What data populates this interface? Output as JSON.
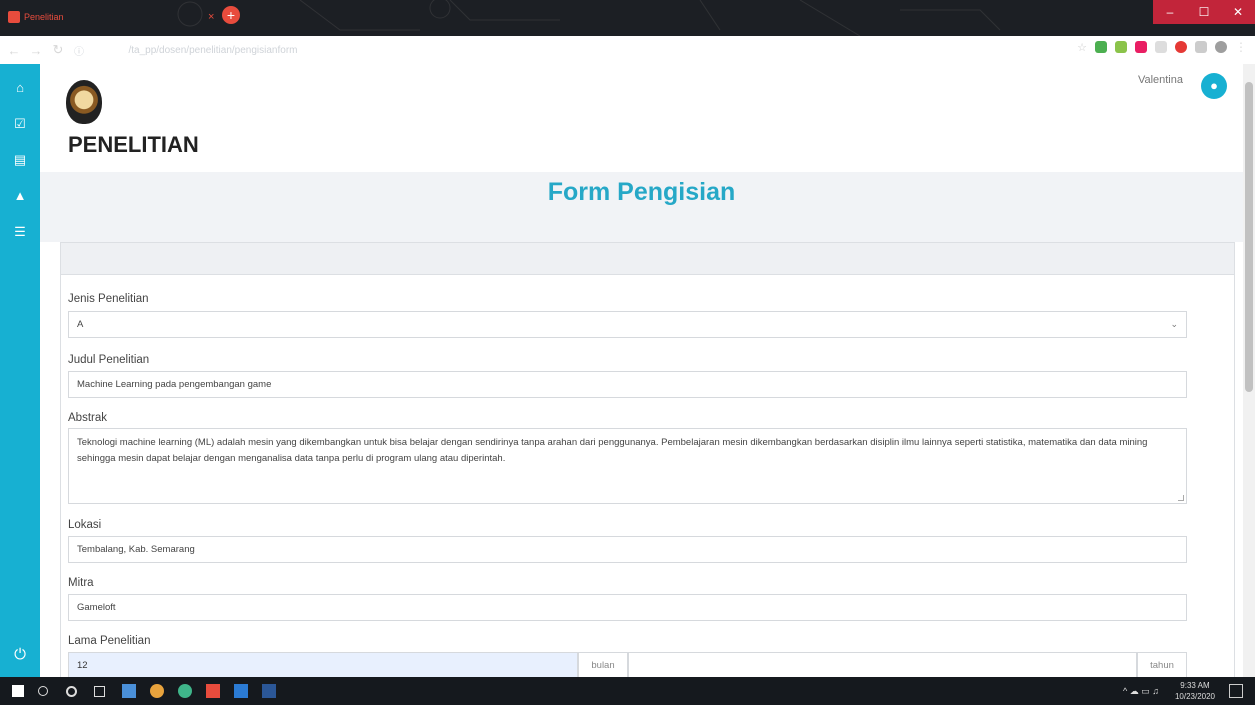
{
  "browser": {
    "tab_title": "Penelitian",
    "url_host": "localhost",
    "url_path": "/ta_pp/dosen/penelitian/pengisianform",
    "new_tab": "+",
    "close_tab": "×"
  },
  "window": {
    "minimize": "–",
    "maximize": "☐",
    "close": "✕"
  },
  "sidebar": {
    "items": [
      {
        "name": "home-icon",
        "glyph": "⌂"
      },
      {
        "name": "checkbox-icon",
        "glyph": "☑"
      },
      {
        "name": "document-icon",
        "glyph": "▤"
      },
      {
        "name": "warning-icon",
        "glyph": "▲"
      },
      {
        "name": "list-icon",
        "glyph": "☰"
      }
    ],
    "power": "⏻"
  },
  "header": {
    "page_title": "PENELITIAN",
    "user_name": "Valentina",
    "avatar_glyph": "●"
  },
  "form": {
    "heading": "Form Pengisian",
    "jenis": {
      "label": "Jenis Penelitian",
      "value": "A",
      "chevron": "⌄"
    },
    "judul": {
      "label": "Judul Penelitian",
      "value": "Machine Learning pada pengembangan game"
    },
    "abstrak": {
      "label": "Abstrak",
      "value": "Teknologi machine learning (ML) adalah mesin yang dikembangkan untuk bisa belajar dengan sendirinya tanpa arahan dari penggunanya. Pembelajaran mesin dikembangkan berdasarkan disiplin ilmu lainnya seperti statistika, matematika dan data mining sehingga mesin dapat belajar dengan menganalisa data tanpa perlu di program ulang atau diperintah."
    },
    "lokasi": {
      "label": "Lokasi",
      "value": "Tembalang, Kab. Semarang"
    },
    "mitra": {
      "label": "Mitra",
      "value": "Gameloft"
    },
    "lama": {
      "label": "Lama Penelitian",
      "value": "12",
      "unit_bulan": "bulan",
      "unit_tahun": "tahun"
    }
  },
  "taskbar": {
    "time": "9:33 AM",
    "date": "10/23/2020"
  },
  "colors": {
    "accent": "#17b0d2",
    "heading": "#26a8c7",
    "chrome": "#1c1f24"
  }
}
